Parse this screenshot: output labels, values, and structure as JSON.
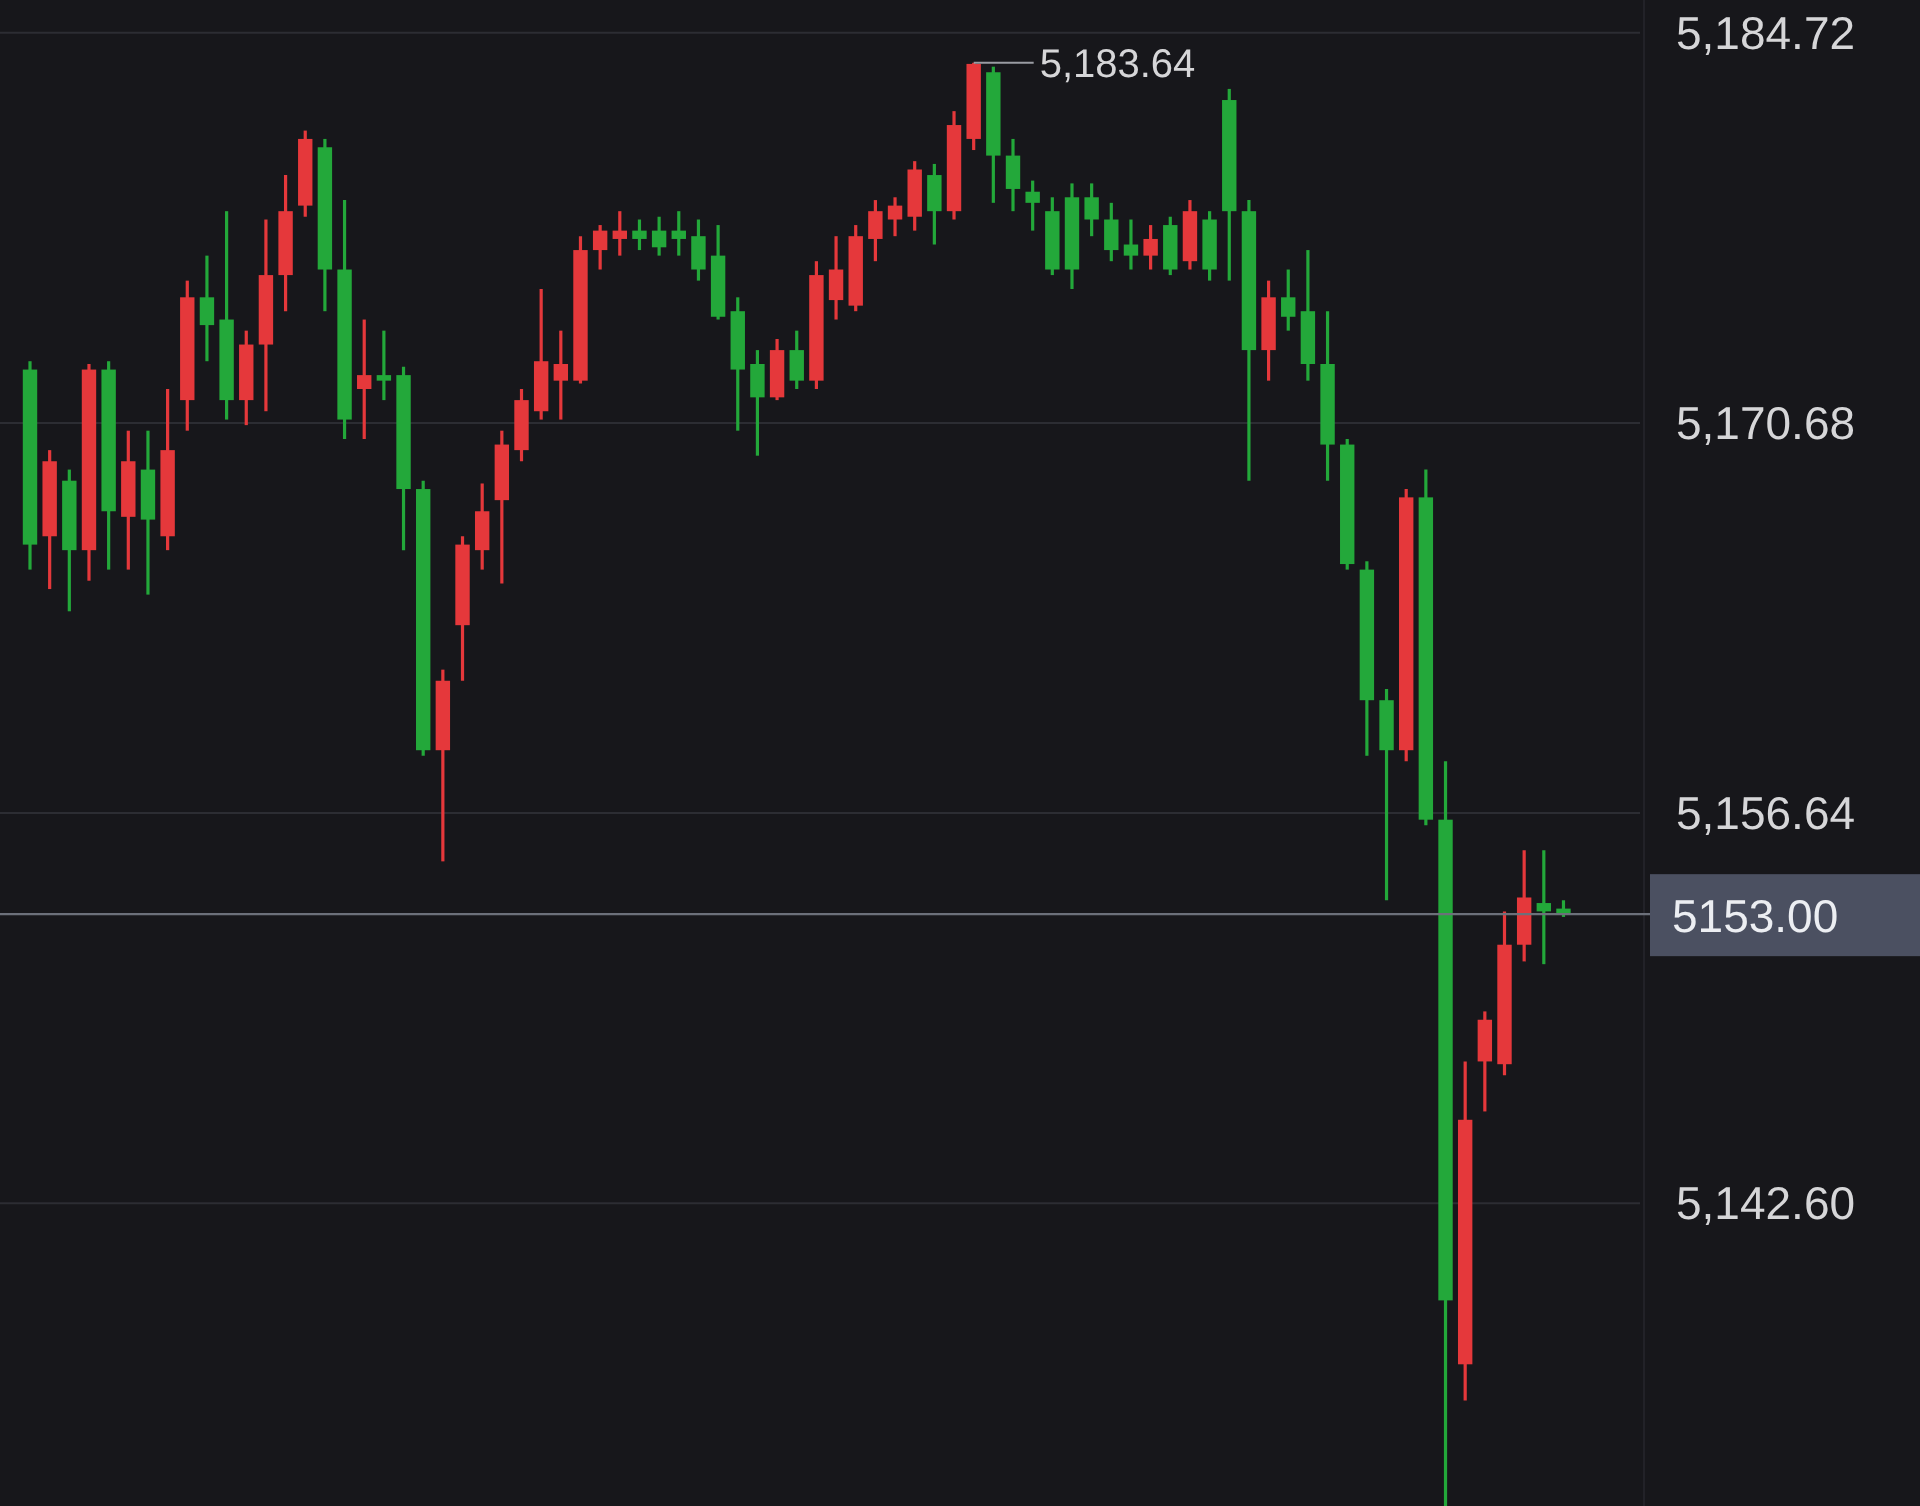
{
  "chart_data": {
    "type": "candlestick",
    "grid": true,
    "ylim": [
      5131.7,
      5185.9
    ],
    "yticks": [
      {
        "value": 5184.72,
        "label": "5,184.72"
      },
      {
        "value": 5170.68,
        "label": "5,170.68"
      },
      {
        "value": 5156.64,
        "label": "5,156.64"
      },
      {
        "value": 5142.6,
        "label": "5,142.60"
      }
    ],
    "categories": [
      null,
      null,
      null,
      null,
      null,
      null,
      null,
      null,
      null,
      null,
      null,
      null,
      null,
      null,
      null,
      null,
      null,
      null,
      null,
      null,
      null,
      null,
      null,
      null,
      null,
      null,
      null,
      null,
      null,
      null,
      null,
      null,
      null,
      null,
      null,
      null,
      null,
      null,
      null,
      null,
      null,
      null,
      null,
      null,
      null,
      null,
      null,
      null,
      null,
      null,
      null,
      null,
      null,
      null,
      null,
      null,
      null,
      null,
      null,
      null,
      null,
      null,
      null,
      null,
      null,
      null,
      null,
      null,
      null,
      null,
      null,
      null,
      null,
      null,
      null,
      null,
      null,
      null,
      null
    ],
    "ohlc": [
      [
        5172.6,
        5172.9,
        5165.4,
        5166.3
      ],
      [
        5166.6,
        5169.7,
        5164.7,
        5169.3
      ],
      [
        5168.6,
        5169.0,
        5163.9,
        5166.1
      ],
      [
        5166.1,
        5172.8,
        5165.0,
        5172.6
      ],
      [
        5172.6,
        5172.9,
        5165.4,
        5167.5
      ],
      [
        5167.3,
        5170.4,
        5165.4,
        5169.3
      ],
      [
        5169.0,
        5170.4,
        5164.5,
        5167.2
      ],
      [
        5166.6,
        5171.9,
        5166.1,
        5169.7
      ],
      [
        5171.5,
        5175.8,
        5170.4,
        5175.2
      ],
      [
        5175.2,
        5176.7,
        5172.9,
        5174.2
      ],
      [
        5174.4,
        5178.3,
        5170.8,
        5171.5
      ],
      [
        5171.5,
        5174.0,
        5170.6,
        5173.5
      ],
      [
        5173.5,
        5178.0,
        5171.1,
        5176.0
      ],
      [
        5176.0,
        5179.6,
        5174.7,
        5178.3
      ],
      [
        5178.5,
        5181.2,
        5178.1,
        5180.9
      ],
      [
        5180.6,
        5180.9,
        5174.7,
        5176.2
      ],
      [
        5176.2,
        5178.7,
        5170.1,
        5170.8
      ],
      [
        5171.9,
        5174.4,
        5170.1,
        5172.4
      ],
      [
        5172.4,
        5174.0,
        5171.5,
        5172.2
      ],
      [
        5172.4,
        5172.7,
        5166.1,
        5168.3
      ],
      [
        5168.3,
        5168.6,
        5158.7,
        5158.9
      ],
      [
        5158.9,
        5161.8,
        5154.9,
        5161.4
      ],
      [
        5163.4,
        5166.6,
        5161.4,
        5166.3
      ],
      [
        5166.1,
        5168.5,
        5165.4,
        5167.5
      ],
      [
        5167.9,
        5170.4,
        5164.9,
        5169.9
      ],
      [
        5169.7,
        5171.9,
        5169.3,
        5171.5
      ],
      [
        5171.1,
        5175.5,
        5170.8,
        5172.9
      ],
      [
        5172.2,
        5174.0,
        5170.8,
        5172.8
      ],
      [
        5172.2,
        5177.4,
        5172.1,
        5176.9
      ],
      [
        5176.9,
        5177.8,
        5176.2,
        5177.6
      ],
      [
        5177.3,
        5178.3,
        5176.7,
        5177.6
      ],
      [
        5177.6,
        5178.0,
        5176.9,
        5177.3
      ],
      [
        5177.6,
        5178.1,
        5176.7,
        5177.0
      ],
      [
        5177.6,
        5178.3,
        5176.7,
        5177.3
      ],
      [
        5177.4,
        5178.0,
        5175.8,
        5176.2
      ],
      [
        5176.7,
        5177.8,
        5174.4,
        5174.5
      ],
      [
        5174.7,
        5175.2,
        5170.4,
        5172.6
      ],
      [
        5172.8,
        5173.3,
        5169.5,
        5171.6
      ],
      [
        5171.6,
        5173.7,
        5171.5,
        5173.3
      ],
      [
        5173.3,
        5174.0,
        5171.9,
        5172.2
      ],
      [
        5172.2,
        5176.5,
        5171.9,
        5176.0
      ],
      [
        5175.1,
        5177.4,
        5174.4,
        5176.2
      ],
      [
        5174.9,
        5177.8,
        5174.7,
        5177.4
      ],
      [
        5177.3,
        5178.7,
        5176.5,
        5178.3
      ],
      [
        5178.0,
        5178.8,
        5177.4,
        5178.5
      ],
      [
        5178.1,
        5180.1,
        5177.6,
        5179.8
      ],
      [
        5179.6,
        5180.0,
        5177.1,
        5178.3
      ],
      [
        5178.3,
        5181.9,
        5178.0,
        5181.4
      ],
      [
        5180.9,
        5183.64,
        5180.5,
        5183.6
      ],
      [
        5183.3,
        5183.5,
        5178.6,
        5180.3
      ],
      [
        5180.3,
        5180.9,
        5178.3,
        5179.1
      ],
      [
        5179.0,
        5179.4,
        5177.6,
        5178.6
      ],
      [
        5178.3,
        5178.8,
        5176.0,
        5176.2
      ],
      [
        5178.8,
        5179.3,
        5175.5,
        5176.2
      ],
      [
        5178.8,
        5179.3,
        5177.4,
        5178.0
      ],
      [
        5178.0,
        5178.6,
        5176.5,
        5176.9
      ],
      [
        5177.1,
        5178.0,
        5176.2,
        5176.7
      ],
      [
        5176.7,
        5177.8,
        5176.2,
        5177.3
      ],
      [
        5177.8,
        5178.1,
        5176.0,
        5176.2
      ],
      [
        5176.5,
        5178.7,
        5176.2,
        5178.3
      ],
      [
        5178.0,
        5178.3,
        5175.8,
        5176.2
      ],
      [
        5182.3,
        5182.7,
        5175.8,
        5178.3
      ],
      [
        5178.3,
        5178.7,
        5168.6,
        5173.3
      ],
      [
        5173.3,
        5175.8,
        5172.2,
        5175.2
      ],
      [
        5175.2,
        5176.2,
        5174.0,
        5174.5
      ],
      [
        5174.7,
        5176.9,
        5172.2,
        5172.8
      ],
      [
        5172.8,
        5174.7,
        5168.6,
        5169.9
      ],
      [
        5169.9,
        5170.1,
        5165.4,
        5165.6
      ],
      [
        5165.4,
        5165.7,
        5158.7,
        5160.7
      ],
      [
        5160.7,
        5161.1,
        5153.5,
        5158.9
      ],
      [
        5158.9,
        5168.3,
        5158.5,
        5168.0
      ],
      [
        5168.0,
        5169.0,
        5156.2,
        5156.4
      ],
      [
        5156.4,
        5158.5,
        5131.7,
        5139.1
      ],
      [
        5136.8,
        5147.7,
        5135.5,
        5145.6
      ],
      [
        5147.7,
        5149.5,
        5145.9,
        5149.2
      ],
      [
        5147.6,
        5153.1,
        5147.2,
        5151.9
      ],
      [
        5151.9,
        5155.3,
        5151.3,
        5153.6
      ],
      [
        5153.4,
        5155.3,
        5151.2,
        5153.1
      ],
      [
        5153.2,
        5153.5,
        5152.9,
        5153.0
      ]
    ],
    "annotations": [
      "5,183.64"
    ],
    "ref_lines": [
      {
        "axis": "y",
        "value": 5153.0,
        "label": "5153.00"
      }
    ]
  }
}
